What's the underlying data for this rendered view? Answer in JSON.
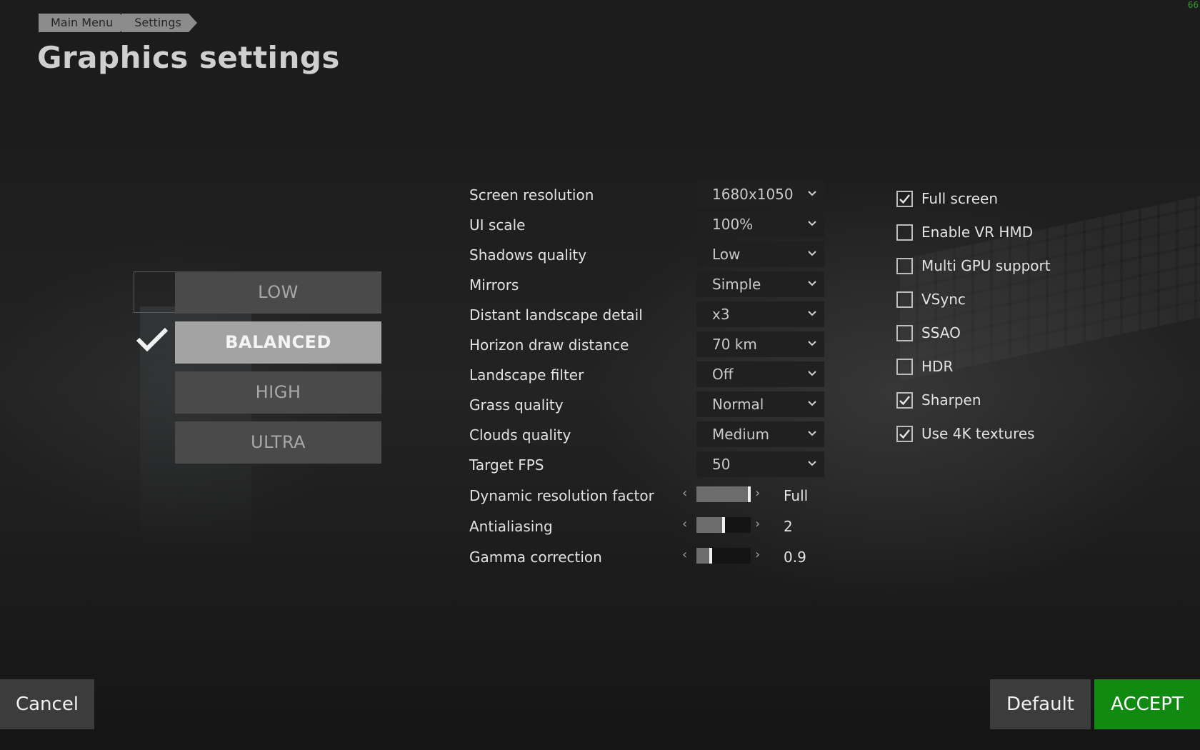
{
  "fps_counter": "66",
  "breadcrumb": [
    "Main Menu",
    "Settings"
  ],
  "page_title": "Graphics settings",
  "presets": {
    "items": [
      "LOW",
      "BALANCED",
      "HIGH",
      "ULTRA"
    ],
    "selected": "BALANCED"
  },
  "dropdowns": [
    {
      "label": "Screen resolution",
      "value": "1680x1050"
    },
    {
      "label": "UI scale",
      "value": "100%"
    },
    {
      "label": "Shadows quality",
      "value": "Low"
    },
    {
      "label": "Mirrors",
      "value": "Simple"
    },
    {
      "label": "Distant landscape detail",
      "value": "x3"
    },
    {
      "label": "Horizon draw distance",
      "value": "70 km"
    },
    {
      "label": "Landscape filter",
      "value": "Off"
    },
    {
      "label": "Grass quality",
      "value": "Normal"
    },
    {
      "label": "Clouds quality",
      "value": "Medium"
    },
    {
      "label": "Target FPS",
      "value": "50"
    }
  ],
  "sliders": [
    {
      "label": "Dynamic resolution factor",
      "value": "Full",
      "level": 1.0
    },
    {
      "label": "Antialiasing",
      "value": "2",
      "level": 0.5
    },
    {
      "label": "Gamma correction",
      "value": "0.9",
      "level": 0.25
    }
  ],
  "checkboxes": [
    {
      "label": "Full screen",
      "checked": true
    },
    {
      "label": "Enable VR HMD",
      "checked": false
    },
    {
      "label": "Multi GPU support",
      "checked": false
    },
    {
      "label": "VSync",
      "checked": false
    },
    {
      "label": "SSAO",
      "checked": false
    },
    {
      "label": "HDR",
      "checked": false
    },
    {
      "label": "Sharpen",
      "checked": true
    },
    {
      "label": "Use 4K textures",
      "checked": true
    }
  ],
  "buttons": {
    "cancel": "Cancel",
    "default": "Default",
    "accept": "ACCEPT"
  },
  "colors": {
    "accent": "#118a11",
    "preset_active": "#a3a3a3",
    "preset_inactive": "#4a4a4a"
  }
}
